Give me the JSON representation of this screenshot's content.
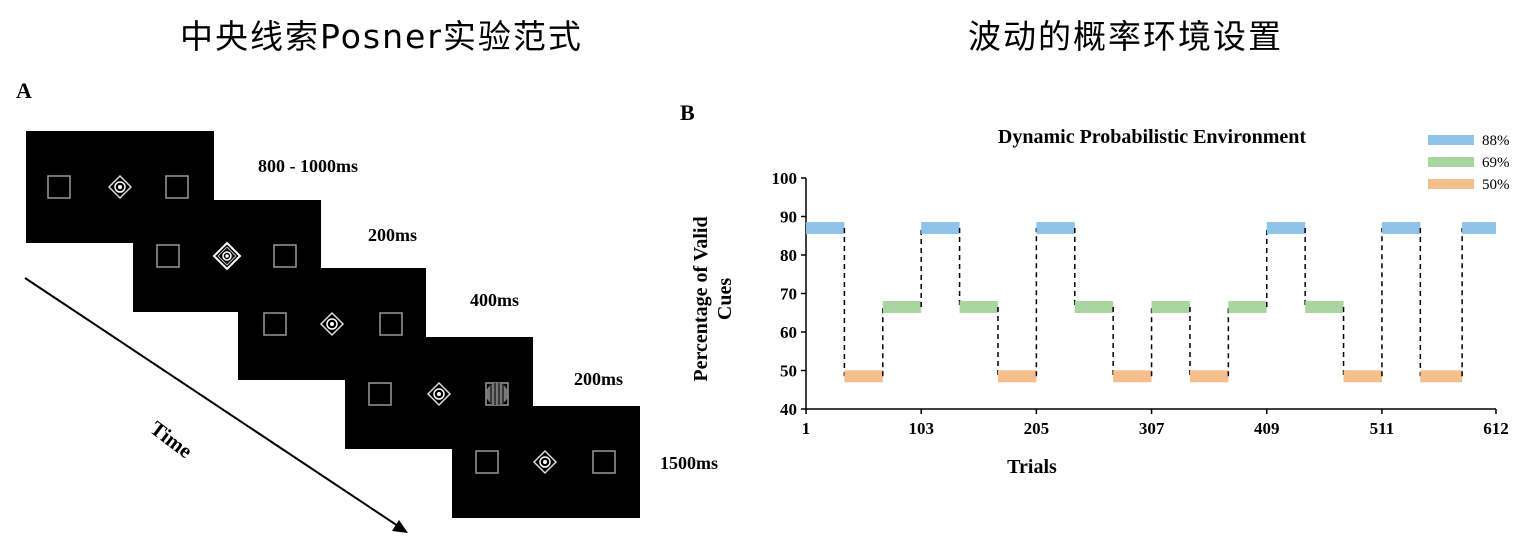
{
  "titles": {
    "left": "中央线索Posner实验范式",
    "right": "波动的概率环境设置"
  },
  "panels": {
    "a": "A",
    "b": "B"
  },
  "posner": {
    "timings": [
      "800 - 1000ms",
      "200ms",
      "400ms",
      "200ms",
      "1500ms"
    ],
    "time_label": "Time",
    "screen_color": "#000000"
  },
  "chart_data": {
    "type": "line",
    "title": "Dynamic Probabilistic Environment",
    "xlabel": "Trials",
    "ylabel_line1": "Percentage of  Valid",
    "ylabel_line2": "Cues",
    "x_ticks": [
      1,
      103,
      205,
      307,
      409,
      511,
      612
    ],
    "xlim": [
      1,
      612
    ],
    "y_ticks": [
      40,
      50,
      60,
      70,
      80,
      90,
      100
    ],
    "ylim": [
      40,
      100
    ],
    "grid": false,
    "legend_placement": "top-right",
    "legend": [
      {
        "label": "88%",
        "color": "#8fc3ea",
        "value": 87
      },
      {
        "label": "69%",
        "color": "#a9d6a0",
        "value": 66.5
      },
      {
        "label": "50%",
        "color": "#f5bf8c",
        "value": 48.5
      }
    ],
    "segments": [
      {
        "start": 1,
        "end": 35,
        "level": "88%"
      },
      {
        "start": 35,
        "end": 69,
        "level": "50%"
      },
      {
        "start": 69,
        "end": 103,
        "level": "69%"
      },
      {
        "start": 103,
        "end": 137,
        "level": "88%"
      },
      {
        "start": 137,
        "end": 171,
        "level": "69%"
      },
      {
        "start": 171,
        "end": 205,
        "level": "50%"
      },
      {
        "start": 205,
        "end": 239,
        "level": "88%"
      },
      {
        "start": 239,
        "end": 273,
        "level": "69%"
      },
      {
        "start": 273,
        "end": 307,
        "level": "50%"
      },
      {
        "start": 307,
        "end": 341,
        "level": "69%"
      },
      {
        "start": 341,
        "end": 375,
        "level": "50%"
      },
      {
        "start": 375,
        "end": 409,
        "level": "69%"
      },
      {
        "start": 409,
        "end": 443,
        "level": "88%"
      },
      {
        "start": 443,
        "end": 477,
        "level": "69%"
      },
      {
        "start": 477,
        "end": 511,
        "level": "50%"
      },
      {
        "start": 511,
        "end": 545,
        "level": "88%"
      },
      {
        "start": 545,
        "end": 582,
        "level": "50%"
      },
      {
        "start": 582,
        "end": 612,
        "level": "88%"
      }
    ]
  }
}
